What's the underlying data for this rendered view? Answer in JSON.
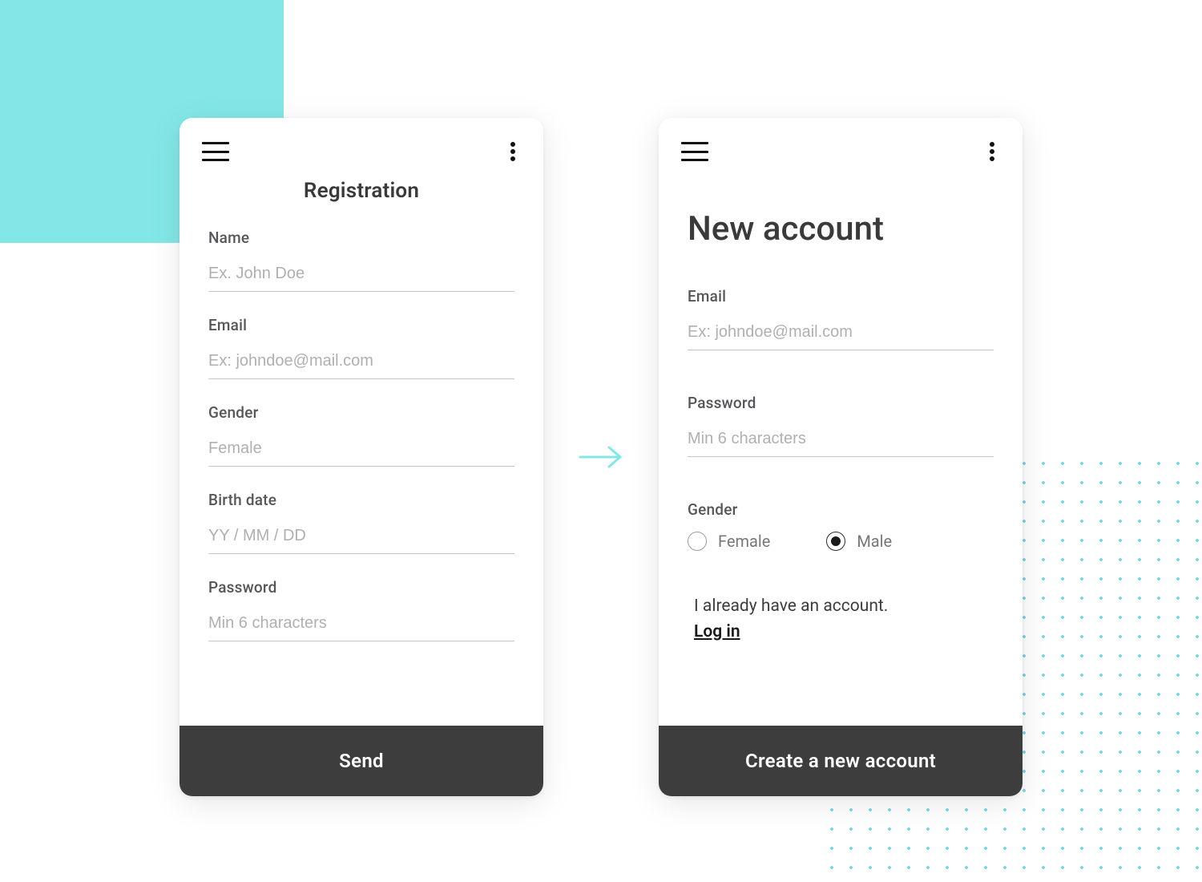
{
  "left": {
    "title": "Registration",
    "fields": {
      "name": {
        "label": "Name",
        "placeholder": "Ex. John Doe"
      },
      "email": {
        "label": "Email",
        "placeholder": "Ex: johndoe@mail.com"
      },
      "gender": {
        "label": "Gender",
        "placeholder": "Female"
      },
      "birthdate": {
        "label": "Birth date",
        "placeholder": "YY / MM / DD"
      },
      "password": {
        "label": "Password",
        "placeholder": "Min 6 characters"
      }
    },
    "cta": "Send"
  },
  "right": {
    "title": "New account",
    "fields": {
      "email": {
        "label": "Email",
        "placeholder": "Ex: johndoe@mail.com"
      },
      "password": {
        "label": "Password",
        "placeholder": "Min 6 characters"
      },
      "gender": {
        "label": "Gender",
        "options": {
          "female": {
            "label": "Female",
            "selected": false
          },
          "male": {
            "label": "Male",
            "selected": true
          }
        }
      }
    },
    "existing_text": "I already have an account.",
    "login_link": "Log in",
    "cta": "Create a new account"
  }
}
